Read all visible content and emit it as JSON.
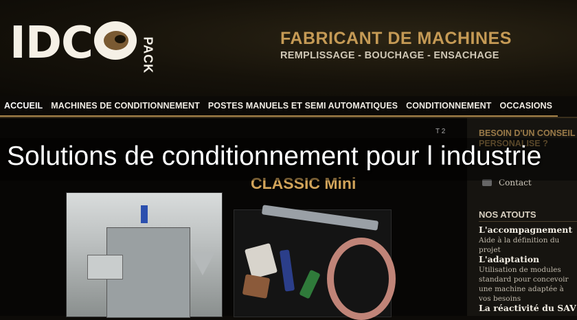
{
  "header": {
    "logo_letters": "IDC",
    "logo_sub": "PACK",
    "tagline_main": "FABRICANT DE MACHINES",
    "tagline_sub": "REMPLISSAGE - BOUCHAGE - ENSACHAGE"
  },
  "nav": {
    "items": [
      {
        "label": "ACCUEIL"
      },
      {
        "label": "MACHINES DE CONDITIONNEMENT"
      },
      {
        "label": "POSTES MANUELS ET SEMI AUTOMATIQUES"
      },
      {
        "label": "CONDITIONNEMENT"
      },
      {
        "label": "OCCASIONS"
      }
    ]
  },
  "slide": {
    "title_line2": "CLASSIC Mini",
    "counter": "T 2"
  },
  "sidebar": {
    "heading": "BESOIN D'UN CONSEIL PERSONALISE ?",
    "contact_label": "Contact",
    "atouts_title": "NOS ATOUTS",
    "atouts": [
      {
        "title": "L'accompagnement",
        "desc": "Aide à la définition du projet"
      },
      {
        "title": "L'adaptation",
        "desc": "Utilisation de modules standard pour concevoir une machine adaptée à vos besoins"
      },
      {
        "title": "La réactivité du SAV",
        "desc": ""
      }
    ]
  },
  "overlay_caption": "Solutions de conditionnement pour l industrie",
  "colors": {
    "accent_gold": "#c59a55",
    "nav_underline": "#a8844a",
    "sidebar_heading": "#9a7a48"
  }
}
